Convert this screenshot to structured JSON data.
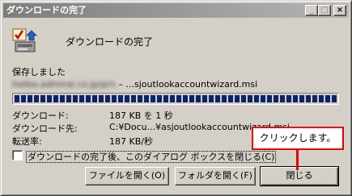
{
  "window": {
    "title": "ダウンロードの完了",
    "title_buttons": [
      "_",
      "□",
      "×"
    ]
  },
  "dialog": {
    "icon": "download-complete-icon",
    "heading": "ダウンロードの完了",
    "saved_label": "保存しました",
    "file_source_blurred": "hotbo.admiral.co.jp/private",
    "file_separator": " – ",
    "file_name": "...sjoutlookaccountwizard.msi",
    "progress_percent": 100,
    "info": [
      {
        "label": "ダウンロード:",
        "value": "187 KB を 1 秒"
      },
      {
        "label": "ダウンロード先:",
        "value": "C:¥Docu...¥asjoutlookaccountwizard.msi"
      },
      {
        "label": "転送率:",
        "value": "187 KB/秒"
      }
    ],
    "checkbox_label": "ダウンロードの完了後、このダイアログ ボックスを閉じる(C)",
    "checkbox_checked": false
  },
  "buttons": {
    "open_file": "ファイルを開く(O)",
    "open_folder": "フォルダを開く(F)",
    "close": "閉じる"
  },
  "annotation": {
    "callout_text": "クリックします。",
    "color": "#e00000"
  }
}
